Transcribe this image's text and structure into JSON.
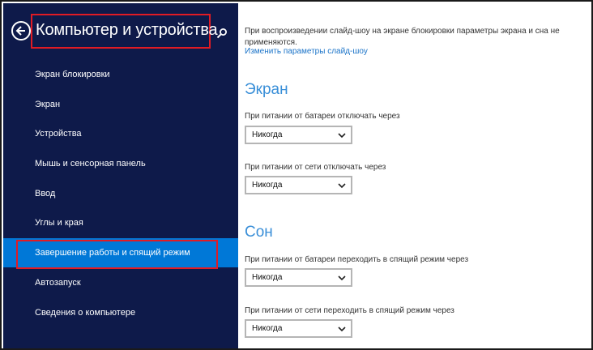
{
  "sidebar": {
    "title": "Компьютер и устройства",
    "back_icon": "back-arrow-icon",
    "search_icon": "search-icon",
    "background": "#0e1a4a",
    "active_color": "#0078d7",
    "highlight_color": "#e01b24",
    "items": [
      {
        "label": "Экран блокировки",
        "active": false
      },
      {
        "label": "Экран",
        "active": false
      },
      {
        "label": "Устройства",
        "active": false
      },
      {
        "label": "Мышь и сенсорная панель",
        "active": false
      },
      {
        "label": "Ввод",
        "active": false
      },
      {
        "label": "Углы и края",
        "active": false
      },
      {
        "label": "Завершение работы и спящий режим",
        "active": true
      },
      {
        "label": "Автозапуск",
        "active": false
      },
      {
        "label": "Сведения о компьютере",
        "active": false
      }
    ]
  },
  "main": {
    "info_text": "При воспроизведении слайд-шоу на экране блокировки параметры экрана и сна не применяются.",
    "link": "Изменить параметры слайд-шоу",
    "screen_section": {
      "title": "Экран",
      "battery_label": "При питании от батареи отключать через",
      "battery_value": "Никогда",
      "ac_label": "При питании от сети отключать через",
      "ac_value": "Никогда"
    },
    "sleep_section": {
      "title": "Сон",
      "battery_label": "При питании от батареи переходить в спящий режим через",
      "battery_value": "Никогда",
      "ac_label": "При питании от сети переходить в спящий режим через",
      "ac_value": "Никогда"
    },
    "accent_color": "#3a8fd8"
  }
}
